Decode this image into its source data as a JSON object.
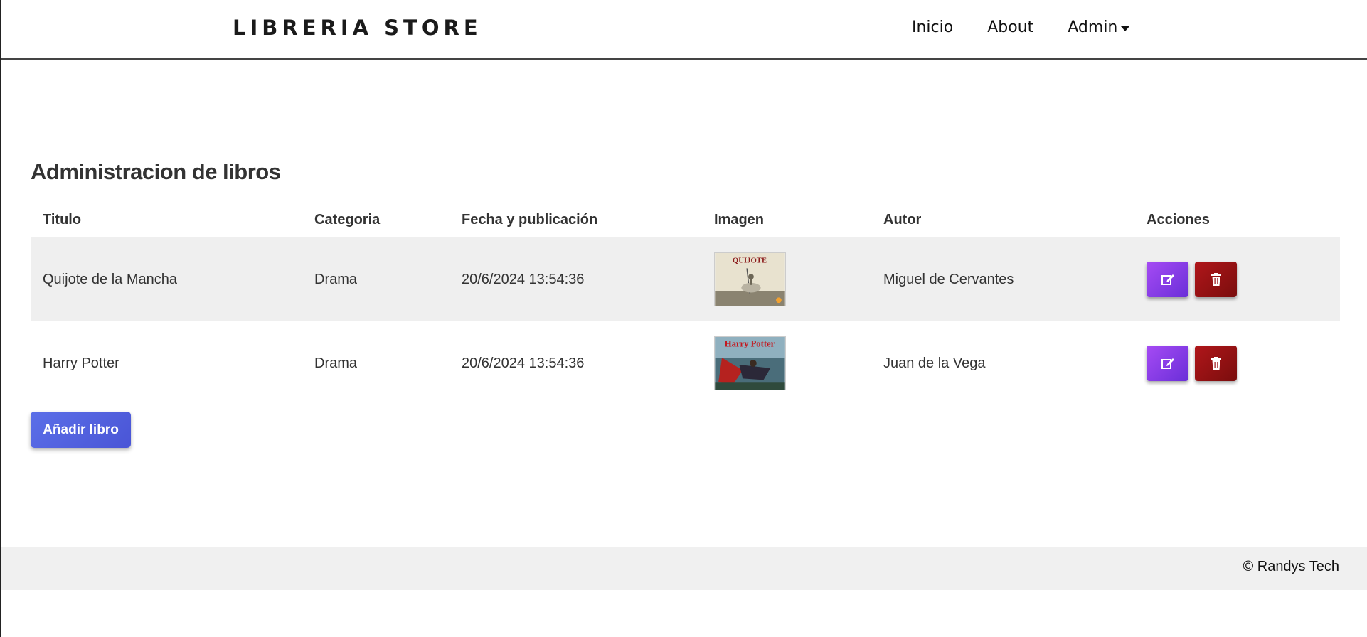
{
  "navbar": {
    "brand": "LIBRERIA STORE",
    "links": [
      {
        "label": "Inicio"
      },
      {
        "label": "About"
      },
      {
        "label": "Admin"
      }
    ]
  },
  "main": {
    "title": "Administracion de libros",
    "table": {
      "headers": [
        "Titulo",
        "Categoria",
        "Fecha y publicación",
        "Imagen",
        "Autor",
        "Acciones"
      ],
      "rows": [
        {
          "titulo": "Quijote de la Mancha",
          "categoria": "Drama",
          "fecha": "20/6/2024 13:54:36",
          "cover_text": "QUIJOTE",
          "autor": "Miguel de Cervantes"
        },
        {
          "titulo": "Harry Potter",
          "categoria": "Drama",
          "fecha": "20/6/2024 13:54:36",
          "cover_text": "Harry Potter",
          "autor": "Juan de la Vega"
        }
      ]
    },
    "add_button": "Añadir libro"
  },
  "footer": {
    "text": "© Randys Tech"
  },
  "icons": {
    "edit": "edit-icon",
    "delete": "trash-icon",
    "dropdown": "caret-down-icon"
  },
  "colors": {
    "edit_button": "#8e44ec",
    "delete_button": "#9b1115",
    "add_button": "#5162e0",
    "row_stripe": "#efefef",
    "footer_bg": "#f0f0f0"
  }
}
